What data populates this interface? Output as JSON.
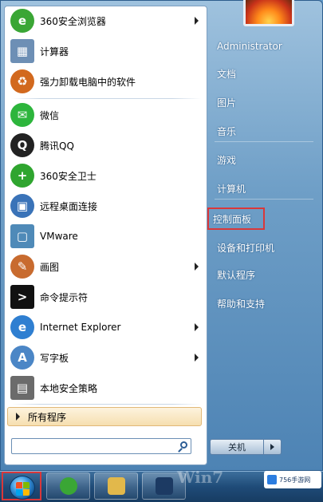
{
  "start_menu": {
    "programs": [
      {
        "label": "360安全浏览器",
        "icon": "360-browser-icon",
        "color": "#3aa635",
        "glyph": "e",
        "submenu": true
      },
      {
        "label": "计算器",
        "icon": "calculator-icon",
        "color": "#6d8fb5",
        "glyph": "▦",
        "submenu": false
      },
      {
        "label": "强力卸载电脑中的软件",
        "icon": "uninstall-icon",
        "color": "#d2691e",
        "glyph": "♻",
        "submenu": false
      },
      {
        "label": "微信",
        "icon": "wechat-icon",
        "color": "#2db53c",
        "glyph": "✉",
        "submenu": false
      },
      {
        "label": "腾讯QQ",
        "icon": "qq-icon",
        "color": "#222222",
        "glyph": "Q",
        "submenu": false
      },
      {
        "label": "360安全卫士",
        "icon": "360-safe-icon",
        "color": "#2fa52f",
        "glyph": "+",
        "submenu": false
      },
      {
        "label": "远程桌面连接",
        "icon": "remote-desktop-icon",
        "color": "#3a73b8",
        "glyph": "▣",
        "submenu": false
      },
      {
        "label": "VMware",
        "icon": "vmware-icon",
        "color": "#4f8ab8",
        "glyph": "▢",
        "submenu": false
      },
      {
        "label": "画图",
        "icon": "paint-icon",
        "color": "#c86b2f",
        "glyph": "✎",
        "submenu": true
      },
      {
        "label": "命令提示符",
        "icon": "cmd-icon",
        "color": "#111111",
        "glyph": ">",
        "submenu": false
      },
      {
        "label": "Internet Explorer",
        "icon": "internet-explorer-icon",
        "color": "#2f7fd1",
        "glyph": "e",
        "submenu": true
      },
      {
        "label": "写字板",
        "icon": "wordpad-icon",
        "color": "#4b86c6",
        "glyph": "A",
        "submenu": true
      },
      {
        "label": "本地安全策略",
        "icon": "security-policy-icon",
        "color": "#6b6b6b",
        "glyph": "▤",
        "submenu": false
      }
    ],
    "all_programs": "所有程序",
    "search_placeholder": "",
    "right_items": [
      "Administrator",
      "文档",
      "图片",
      "音乐",
      "游戏",
      "计算机",
      "控制面板",
      "设备和打印机",
      "默认程序",
      "帮助和支持"
    ],
    "highlighted": "控制面板",
    "shutdown_label": "关机"
  },
  "taskbar": {
    "buttons": [
      {
        "icon": "360-browser-icon",
        "color": "#3aa635"
      },
      {
        "icon": "file-explorer-icon",
        "color": "#e2b84b"
      },
      {
        "icon": "photoshop-icon",
        "color": "#1c3a63"
      }
    ],
    "watermark_text": "756手游网"
  },
  "colors": {
    "highlight_border": "#d9383a",
    "menu_blue": "#4d83b4"
  }
}
